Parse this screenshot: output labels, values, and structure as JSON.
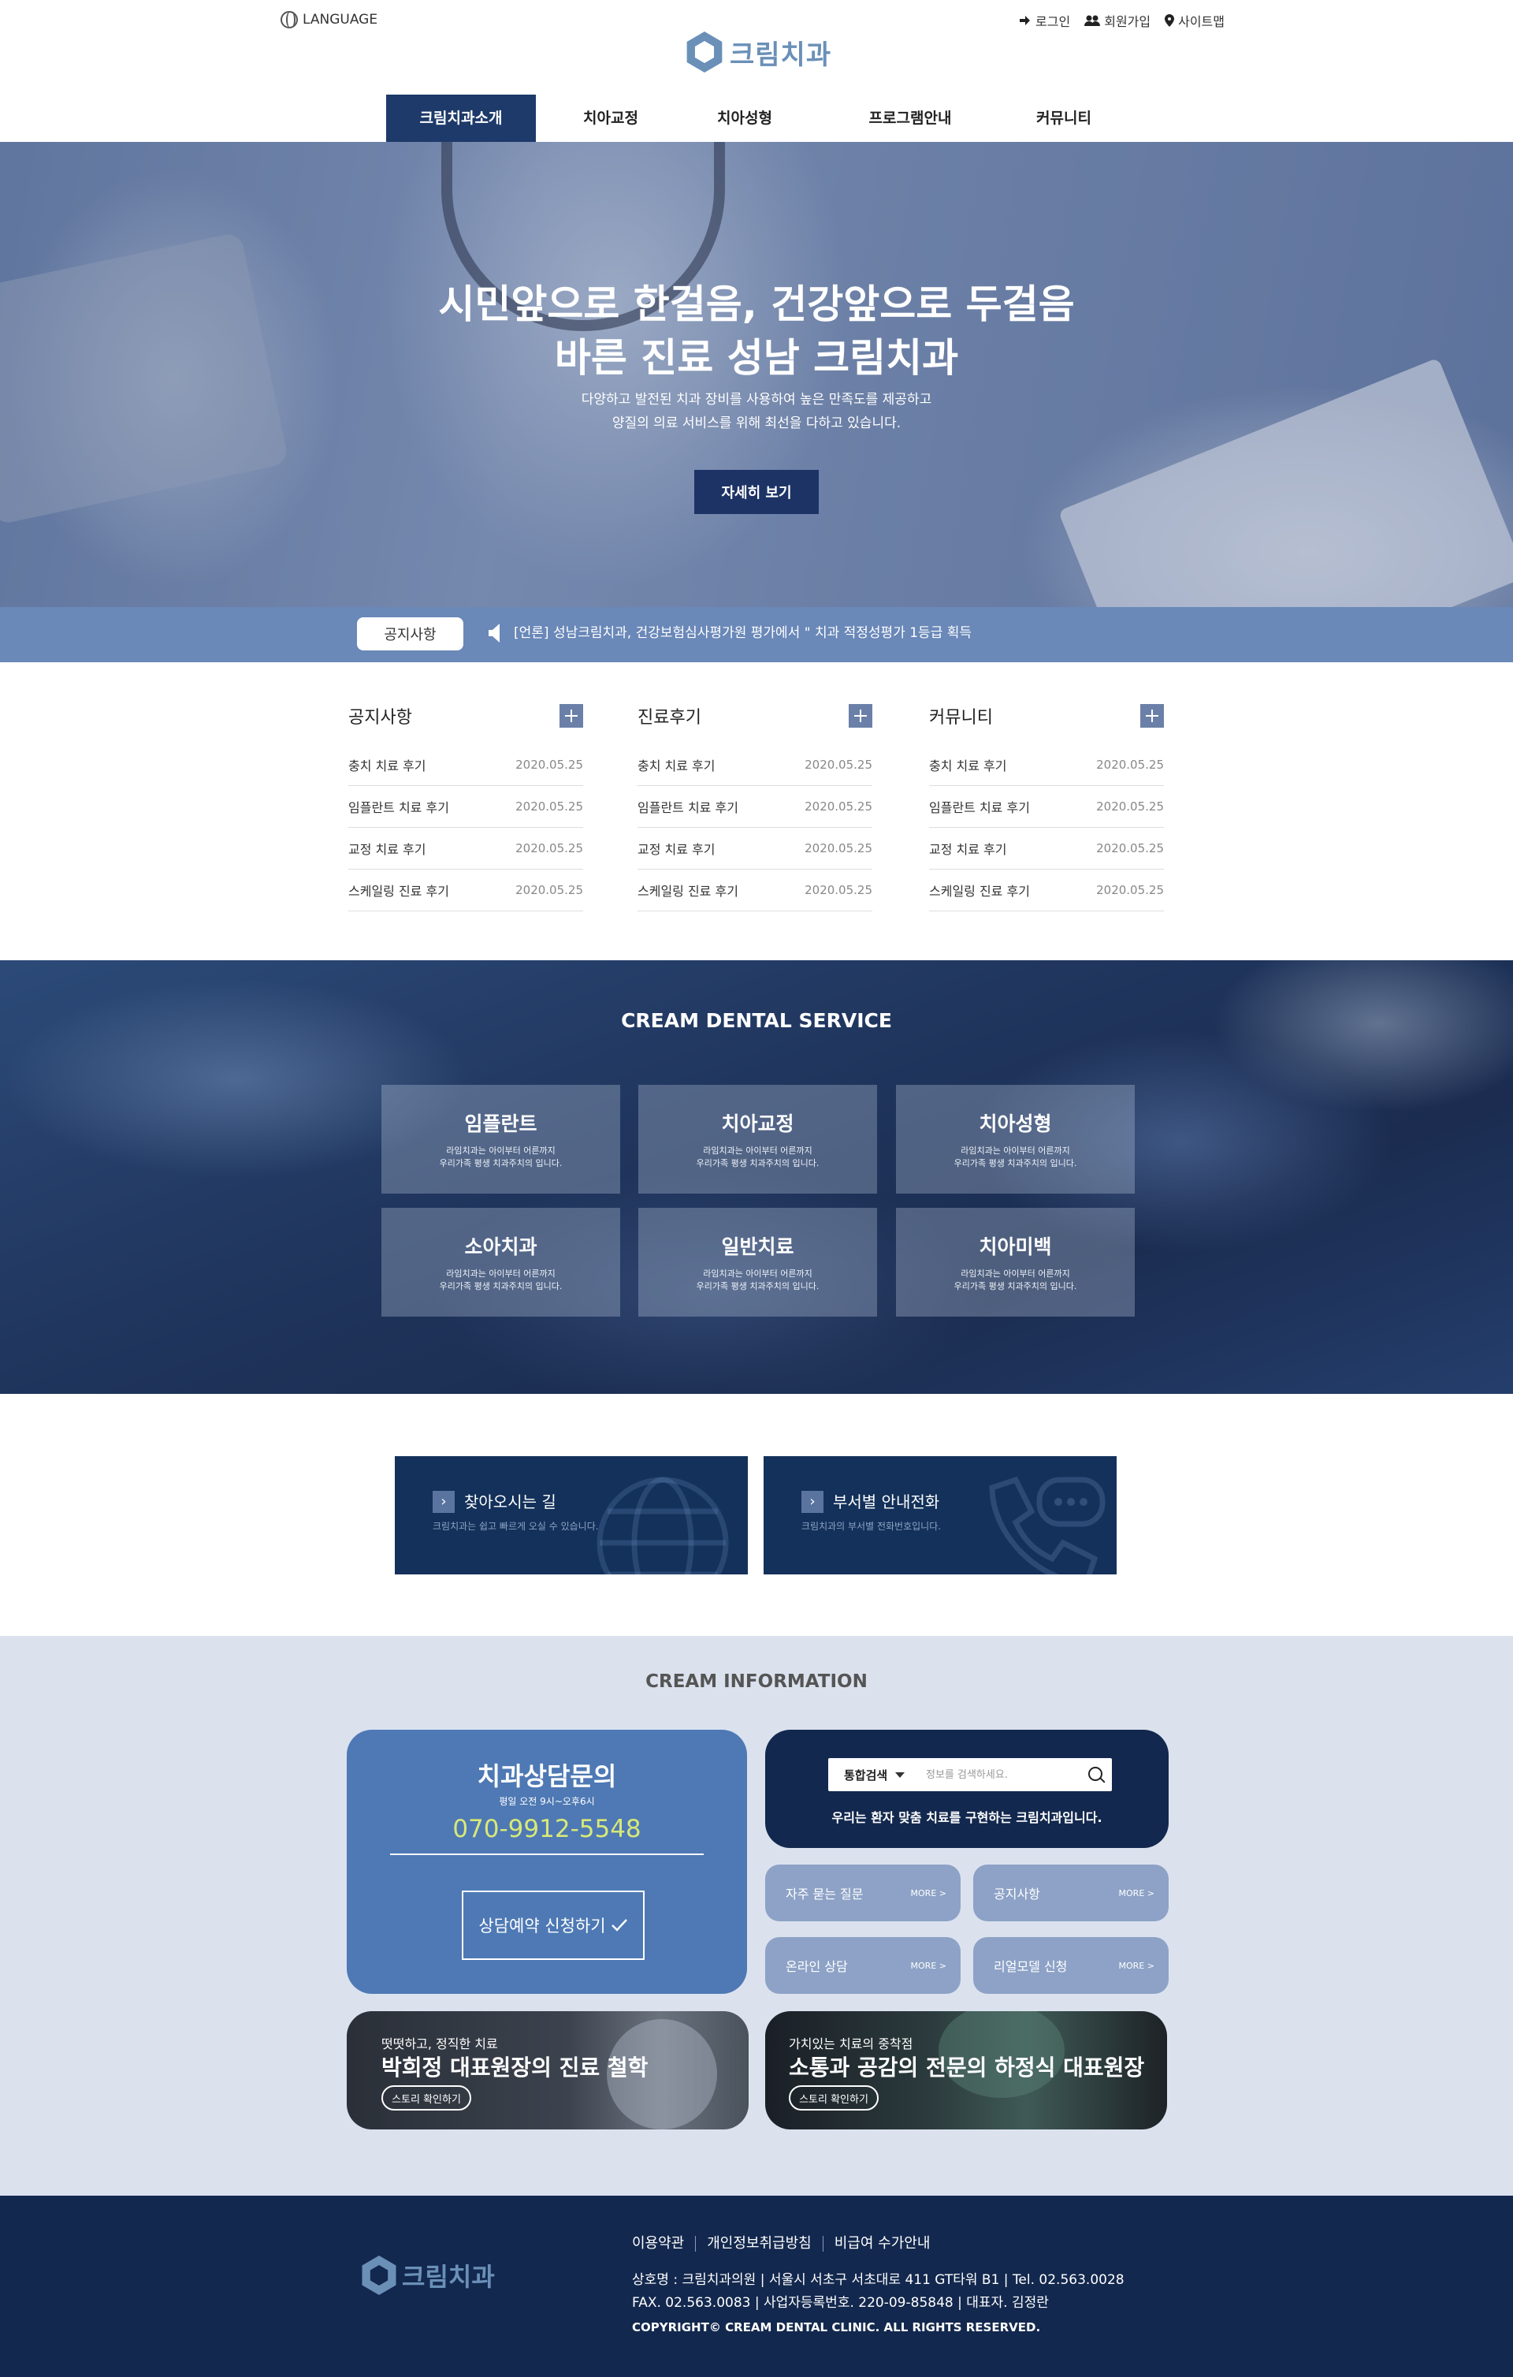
{
  "header": {
    "language": "LANGUAGE",
    "utils": [
      "로그인",
      "회원가입",
      "사이트맵"
    ],
    "logo_text": "크림치과",
    "nav": [
      "크림치과소개",
      "치아교정",
      "치아성형",
      "프로그램안내",
      "커뮤니티"
    ],
    "nav_active_index": 0
  },
  "hero": {
    "title_line1": "시민앞으로 한걸음, 건강앞으로 두걸음",
    "title_line2": "바른 진료 성남 크림치과",
    "desc_line1": "다양하고 발전된 치과 장비를 사용하여 높은 만족도를 제공하고",
    "desc_line2": "양질의 의료 서비스를 위해  최선을 다하고 있습니다.",
    "button": "자세히 보기"
  },
  "notice_bar": {
    "label": "공지사항",
    "text": "[언론] 성남크림치과, 건강보험심사평가원 평가에서 \" 치과 적정성평가 1등급 획득"
  },
  "boards": [
    {
      "title": "공지사항",
      "items": [
        {
          "title": "충치 치료 후기",
          "date": "2020.05.25"
        },
        {
          "title": "임플란트 치료 후기",
          "date": "2020.05.25"
        },
        {
          "title": "교정 치료 후기",
          "date": "2020.05.25"
        },
        {
          "title": "스케일링 진료 후기",
          "date": "2020.05.25"
        }
      ]
    },
    {
      "title": "진료후기",
      "items": [
        {
          "title": "충치 치료 후기",
          "date": "2020.05.25"
        },
        {
          "title": "임플란트 치료 후기",
          "date": "2020.05.25"
        },
        {
          "title": "교정 치료 후기",
          "date": "2020.05.25"
        },
        {
          "title": "스케일링 진료 후기",
          "date": "2020.05.25"
        }
      ]
    },
    {
      "title": "커뮤니티",
      "items": [
        {
          "title": "충치 치료 후기",
          "date": "2020.05.25"
        },
        {
          "title": "임플란트 치료 후기",
          "date": "2020.05.25"
        },
        {
          "title": "교정 치료 후기",
          "date": "2020.05.25"
        },
        {
          "title": "스케일링 진료 후기",
          "date": "2020.05.25"
        }
      ]
    }
  ],
  "service": {
    "title": "CREAM DENTAL SERVICE",
    "items": [
      {
        "name": "임플란트",
        "desc1": "라임치과는 아이부터 어른까지",
        "desc2": "우리가족 평생 치과주치의 입니다."
      },
      {
        "name": "치아교정",
        "desc1": "라임치과는 아이부터 어른까지",
        "desc2": "우리가족 평생 치과주치의 입니다."
      },
      {
        "name": "치아성형",
        "desc1": "라임치과는 아이부터 어른까지",
        "desc2": "우리가족 평생 치과주치의 입니다."
      },
      {
        "name": "소아치과",
        "desc1": "라임치과는 아이부터 어른까지",
        "desc2": "우리가족 평생 치과주치의 입니다."
      },
      {
        "name": "일반치료",
        "desc1": "라임치과는 아이부터 어른까지",
        "desc2": "우리가족 평생 치과주치의 입니다."
      },
      {
        "name": "치아미백",
        "desc1": "라임치과는 아이부터 어른까지",
        "desc2": "우리가족 평생 치과주치의 입니다."
      }
    ]
  },
  "quick": [
    {
      "title": "찾아오시는 길",
      "desc": "크림치과는 쉽고 빠르게 오실 수 있습니다.",
      "icon": "globe-icon"
    },
    {
      "title": "부서별 안내전화",
      "desc": "크림치과의 부서별 전화번호입니다.",
      "icon": "phone-chat-icon"
    }
  ],
  "info": {
    "title": "CREAM INFORMATION",
    "consult": {
      "title": "치과상담문의",
      "hours": "평일 오전 9시~오후6시",
      "phone": "070-9912-5548",
      "button": "상담예약 신청하기"
    },
    "search": {
      "category": "통합검색",
      "placeholder": "정보를 검색하세요.",
      "caption": "우리는  환자 맞춤 치료를 구현하는 크림치과입니다."
    },
    "pills": [
      {
        "label": "자주 묻는 질문",
        "more": "MORE >"
      },
      {
        "label": "공지사항",
        "more": "MORE >"
      },
      {
        "label": "온라인 상담",
        "more": "MORE >"
      },
      {
        "label": "리얼모델 신청",
        "more": "MORE >"
      }
    ],
    "stories": [
      {
        "sub": "떳떳하고, 정직한 치료",
        "main": "박희정 대표원장의 진료 철학",
        "button": "스토리 확인하기"
      },
      {
        "sub": "가치있는 치료의 중착점",
        "main": "소통과 공감의 전문의 하정식 대표원장",
        "button": "스토리 확인하기"
      }
    ]
  },
  "footer": {
    "logo_text": "크림치과",
    "links": [
      "이용약관",
      "개인정보취급방침",
      "비급여  수가안내"
    ],
    "info1": "상호명 : 크림치과의원 | 서울시 서초구 서초대로 411 GT타워 B1 | Tel. 02.563.0028",
    "info2": "FAX. 02.563.0083 | 사업자등록번호. 220-09-85848  |  대표자. 김정란",
    "copyright": "COPYRIGHT© CREAM DENTAL CLINIC. ALL RIGHTS RESERVED."
  },
  "colors": {
    "navy": "#1d3a6a",
    "accent_blue": "#4e79b4",
    "notice_blue": "#6a88b8",
    "phone_yellow": "#d8e878",
    "footer_bg": "#13284e"
  }
}
